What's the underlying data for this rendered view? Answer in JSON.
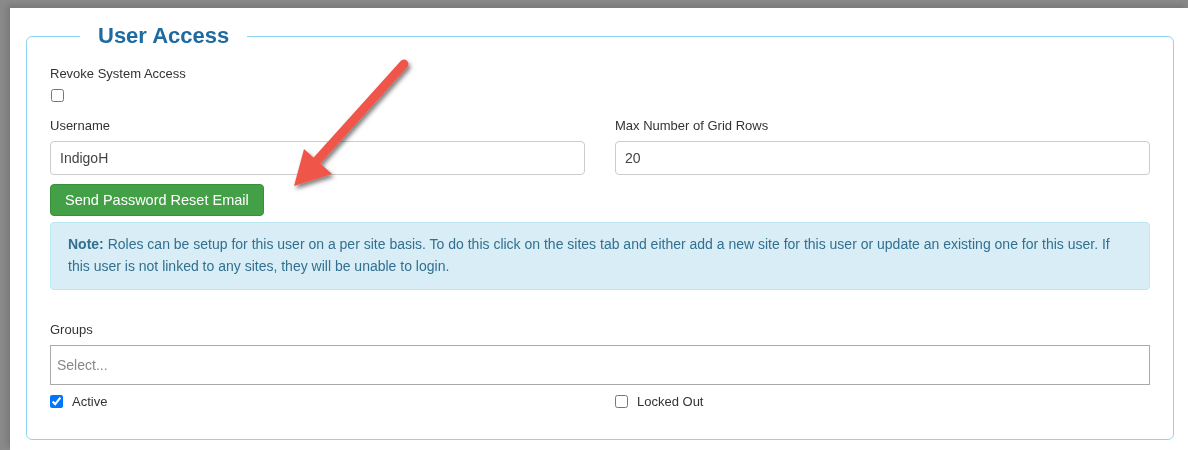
{
  "section": {
    "title": "User Access"
  },
  "revoke": {
    "label": "Revoke System Access",
    "checked": false
  },
  "username": {
    "label": "Username",
    "value": "IndigoH"
  },
  "max_rows": {
    "label": "Max Number of Grid Rows",
    "value": "20"
  },
  "reset_button": "Send Password Reset Email",
  "note": "**Note:** Roles can be setup for this user on a per site basis. To do this click on the sites tab and either add a new site for this user or update an existing one for this user. If this user is not linked to any sites, they will be unable to login.",
  "groups": {
    "label": "Groups",
    "placeholder": "Select..."
  },
  "flags": [
    {
      "label": "Active",
      "checked": true
    },
    {
      "label": "Locked Out",
      "checked": false
    }
  ]
}
